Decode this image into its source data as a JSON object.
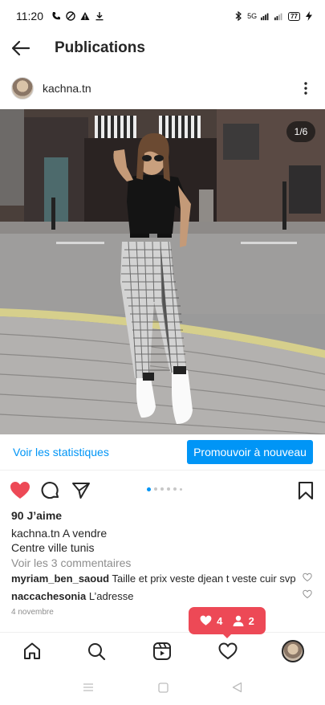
{
  "status_bar": {
    "time": "11:20",
    "network": "5G",
    "battery": "77"
  },
  "header": {
    "title": "Publications"
  },
  "post": {
    "username": "kachna.tn",
    "image_counter": "1/6",
    "stats_link": "Voir les statistiques",
    "promote_button": "Promouvoir à nouveau",
    "liked": true,
    "likes": "90 J’aime",
    "caption_user": "kachna.tn",
    "caption_line1": "A vendre",
    "caption_line2": "Centre ville tunis",
    "view_comments": "Voir les 3 commentaires",
    "comments": [
      {
        "user": "myriam_ben_saoud",
        "text": "Taille et prix veste djean t veste cuir svp"
      },
      {
        "user": "naccachesonia",
        "text": "L’adresse"
      }
    ],
    "date": "4 novembre",
    "carousel_total": 6,
    "carousel_current": 1
  },
  "notification": {
    "likes_count": "4",
    "followers_count": "2"
  },
  "colors": {
    "accent_blue": "#0095f6",
    "like_red": "#ed4956",
    "text": "#262626",
    "muted": "#8e8e8e"
  },
  "icons": {
    "back": "arrow-left-icon",
    "more": "vertical-ellipsis-icon",
    "like": "heart-filled-icon",
    "comment": "speech-bubble-icon",
    "share": "paper-plane-icon",
    "save": "bookmark-icon",
    "home": "home-icon",
    "search": "search-icon",
    "reels": "reels-icon",
    "activity": "heart-outline-icon"
  }
}
